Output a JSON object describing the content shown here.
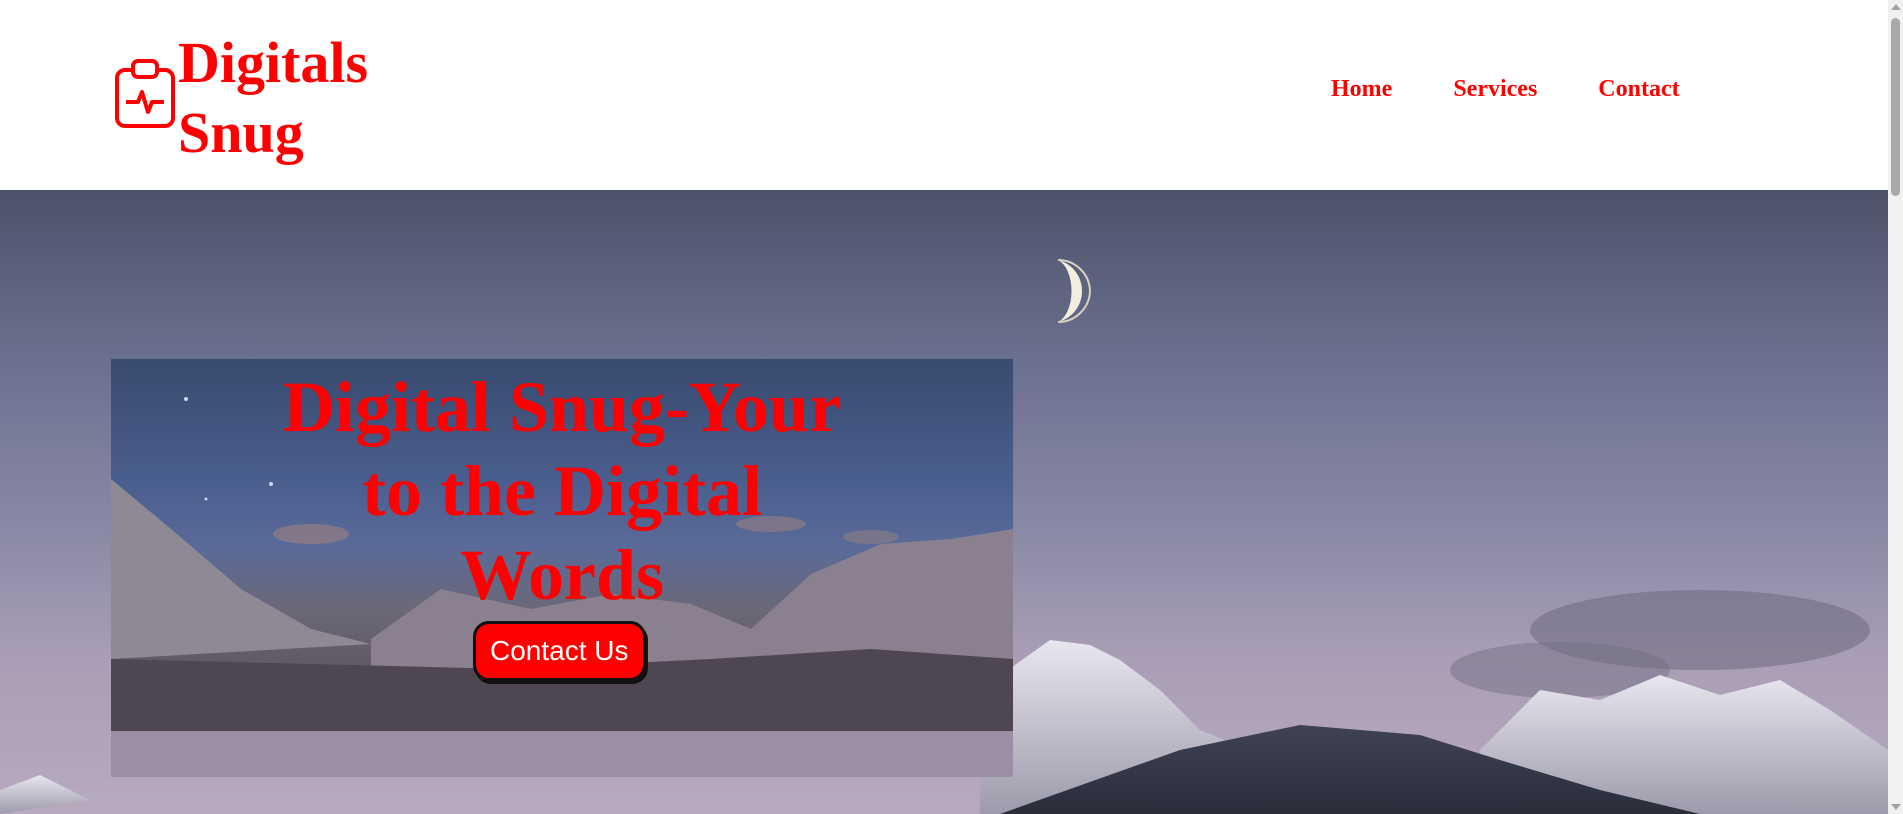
{
  "brand": {
    "name_line1": "Digitals",
    "name_line2": "Snug",
    "icon": "clipboard-pulse-icon",
    "color": "#ff0000"
  },
  "nav": {
    "items": [
      "Home",
      "Services",
      "Contact"
    ]
  },
  "hero": {
    "title": "Digital Snug-Your to the Digital Words",
    "cta_label": "Contact Us",
    "cta_color": "#ff0000",
    "background": "snowy-mountains-moon-night-photo"
  }
}
